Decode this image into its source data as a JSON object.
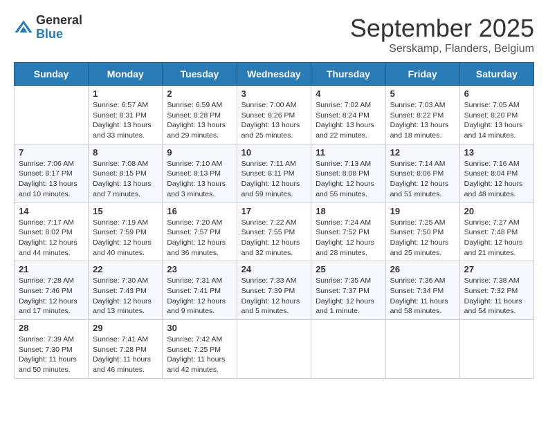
{
  "logo": {
    "general": "General",
    "blue": "Blue"
  },
  "title": "September 2025",
  "subtitle": "Serskamp, Flanders, Belgium",
  "weekdays": [
    "Sunday",
    "Monday",
    "Tuesday",
    "Wednesday",
    "Thursday",
    "Friday",
    "Saturday"
  ],
  "weeks": [
    [
      {
        "day": "",
        "info": ""
      },
      {
        "day": "1",
        "info": "Sunrise: 6:57 AM\nSunset: 8:31 PM\nDaylight: 13 hours\nand 33 minutes."
      },
      {
        "day": "2",
        "info": "Sunrise: 6:59 AM\nSunset: 8:28 PM\nDaylight: 13 hours\nand 29 minutes."
      },
      {
        "day": "3",
        "info": "Sunrise: 7:00 AM\nSunset: 8:26 PM\nDaylight: 13 hours\nand 25 minutes."
      },
      {
        "day": "4",
        "info": "Sunrise: 7:02 AM\nSunset: 8:24 PM\nDaylight: 13 hours\nand 22 minutes."
      },
      {
        "day": "5",
        "info": "Sunrise: 7:03 AM\nSunset: 8:22 PM\nDaylight: 13 hours\nand 18 minutes."
      },
      {
        "day": "6",
        "info": "Sunrise: 7:05 AM\nSunset: 8:20 PM\nDaylight: 13 hours\nand 14 minutes."
      }
    ],
    [
      {
        "day": "7",
        "info": "Sunrise: 7:06 AM\nSunset: 8:17 PM\nDaylight: 13 hours\nand 10 minutes."
      },
      {
        "day": "8",
        "info": "Sunrise: 7:08 AM\nSunset: 8:15 PM\nDaylight: 13 hours\nand 7 minutes."
      },
      {
        "day": "9",
        "info": "Sunrise: 7:10 AM\nSunset: 8:13 PM\nDaylight: 13 hours\nand 3 minutes."
      },
      {
        "day": "10",
        "info": "Sunrise: 7:11 AM\nSunset: 8:11 PM\nDaylight: 12 hours\nand 59 minutes."
      },
      {
        "day": "11",
        "info": "Sunrise: 7:13 AM\nSunset: 8:08 PM\nDaylight: 12 hours\nand 55 minutes."
      },
      {
        "day": "12",
        "info": "Sunrise: 7:14 AM\nSunset: 8:06 PM\nDaylight: 12 hours\nand 51 minutes."
      },
      {
        "day": "13",
        "info": "Sunrise: 7:16 AM\nSunset: 8:04 PM\nDaylight: 12 hours\nand 48 minutes."
      }
    ],
    [
      {
        "day": "14",
        "info": "Sunrise: 7:17 AM\nSunset: 8:02 PM\nDaylight: 12 hours\nand 44 minutes."
      },
      {
        "day": "15",
        "info": "Sunrise: 7:19 AM\nSunset: 7:59 PM\nDaylight: 12 hours\nand 40 minutes."
      },
      {
        "day": "16",
        "info": "Sunrise: 7:20 AM\nSunset: 7:57 PM\nDaylight: 12 hours\nand 36 minutes."
      },
      {
        "day": "17",
        "info": "Sunrise: 7:22 AM\nSunset: 7:55 PM\nDaylight: 12 hours\nand 32 minutes."
      },
      {
        "day": "18",
        "info": "Sunrise: 7:24 AM\nSunset: 7:52 PM\nDaylight: 12 hours\nand 28 minutes."
      },
      {
        "day": "19",
        "info": "Sunrise: 7:25 AM\nSunset: 7:50 PM\nDaylight: 12 hours\nand 25 minutes."
      },
      {
        "day": "20",
        "info": "Sunrise: 7:27 AM\nSunset: 7:48 PM\nDaylight: 12 hours\nand 21 minutes."
      }
    ],
    [
      {
        "day": "21",
        "info": "Sunrise: 7:28 AM\nSunset: 7:46 PM\nDaylight: 12 hours\nand 17 minutes."
      },
      {
        "day": "22",
        "info": "Sunrise: 7:30 AM\nSunset: 7:43 PM\nDaylight: 12 hours\nand 13 minutes."
      },
      {
        "day": "23",
        "info": "Sunrise: 7:31 AM\nSunset: 7:41 PM\nDaylight: 12 hours\nand 9 minutes."
      },
      {
        "day": "24",
        "info": "Sunrise: 7:33 AM\nSunset: 7:39 PM\nDaylight: 12 hours\nand 5 minutes."
      },
      {
        "day": "25",
        "info": "Sunrise: 7:35 AM\nSunset: 7:37 PM\nDaylight: 12 hours\nand 1 minute."
      },
      {
        "day": "26",
        "info": "Sunrise: 7:36 AM\nSunset: 7:34 PM\nDaylight: 11 hours\nand 58 minutes."
      },
      {
        "day": "27",
        "info": "Sunrise: 7:38 AM\nSunset: 7:32 PM\nDaylight: 11 hours\nand 54 minutes."
      }
    ],
    [
      {
        "day": "28",
        "info": "Sunrise: 7:39 AM\nSunset: 7:30 PM\nDaylight: 11 hours\nand 50 minutes."
      },
      {
        "day": "29",
        "info": "Sunrise: 7:41 AM\nSunset: 7:28 PM\nDaylight: 11 hours\nand 46 minutes."
      },
      {
        "day": "30",
        "info": "Sunrise: 7:42 AM\nSunset: 7:25 PM\nDaylight: 11 hours\nand 42 minutes."
      },
      {
        "day": "",
        "info": ""
      },
      {
        "day": "",
        "info": ""
      },
      {
        "day": "",
        "info": ""
      },
      {
        "day": "",
        "info": ""
      }
    ]
  ]
}
